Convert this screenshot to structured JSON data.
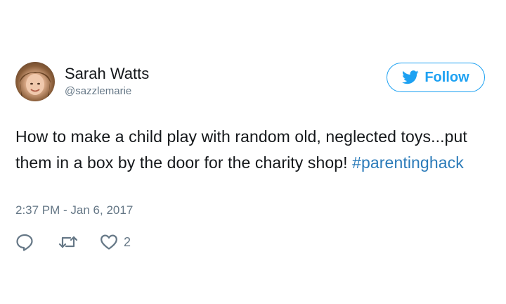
{
  "author": {
    "name": "Sarah Watts",
    "handle": "@sazzlemarie"
  },
  "follow_button": {
    "label": "Follow",
    "icon": "twitter-bird-icon",
    "color": "#1da1f2"
  },
  "tweet": {
    "text": "How to make a child play with random old, neglected toys...put them in a box by the door for the charity shop! ",
    "hashtag": "#parentinghack",
    "hashtag_color": "#2b7bb9",
    "timestamp": "2:37 PM - Jan 6, 2017"
  },
  "actions": {
    "reply_icon": "reply-icon",
    "retweet_icon": "retweet-icon",
    "like_icon": "heart-icon",
    "like_count": "2"
  }
}
